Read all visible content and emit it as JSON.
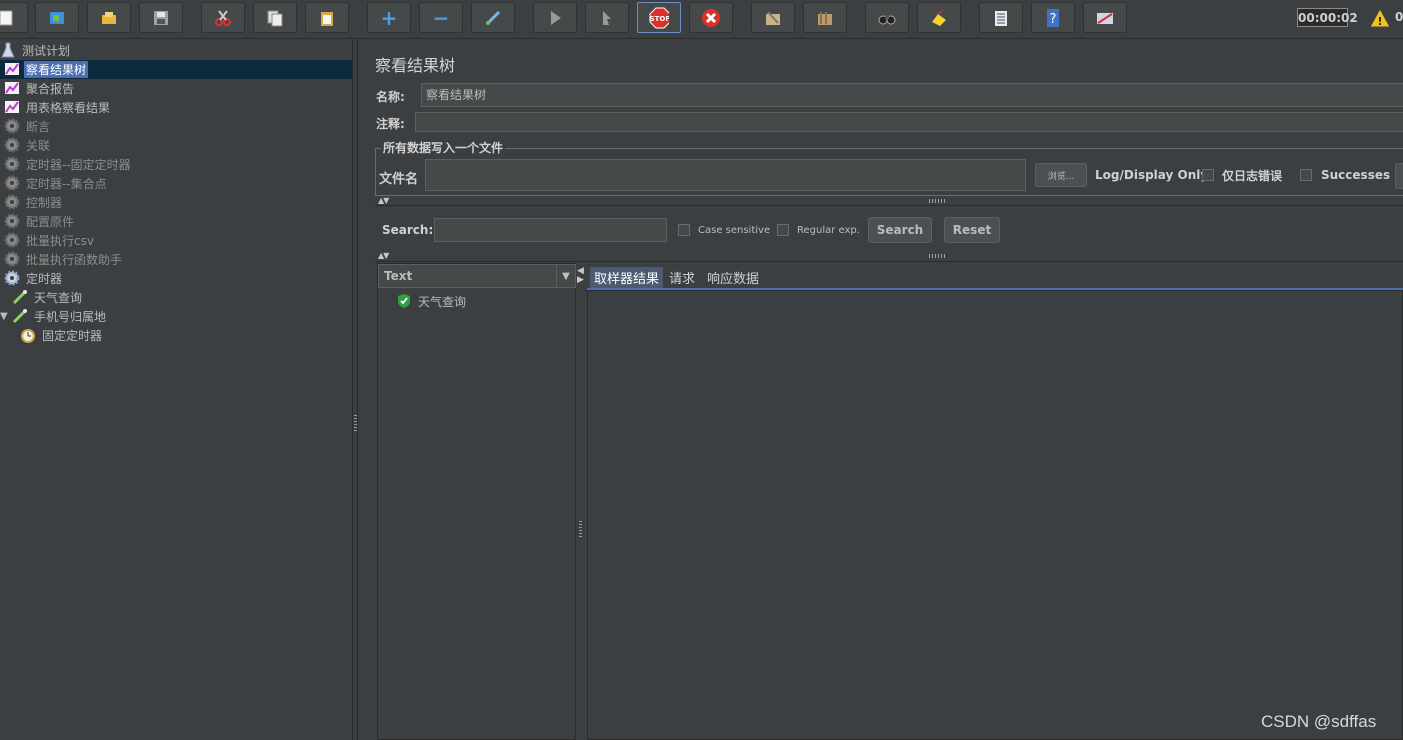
{
  "toolbar": {
    "buttons": [
      {
        "name": "new-icon"
      },
      {
        "name": "templates-icon"
      },
      {
        "name": "open-icon"
      },
      {
        "name": "save-icon"
      },
      {
        "name": "cut-icon"
      },
      {
        "name": "copy-icon"
      },
      {
        "name": "paste-icon"
      },
      {
        "name": "expand-icon"
      },
      {
        "name": "collapse-icon"
      },
      {
        "name": "toggle-icon"
      },
      {
        "name": "start-icon"
      },
      {
        "name": "start-no-pause-icon"
      },
      {
        "name": "stop-icon"
      },
      {
        "name": "shutdown-icon"
      },
      {
        "name": "remote-start-icon"
      },
      {
        "name": "remote-stop-icon"
      },
      {
        "name": "search-icon"
      },
      {
        "name": "clear-icon"
      },
      {
        "name": "function-helper-icon"
      },
      {
        "name": "help-icon"
      },
      {
        "name": "log-viewer-icon"
      }
    ],
    "stop_label": "STOP",
    "timer": "00:00:02",
    "warning_count": "0"
  },
  "tree": {
    "items": [
      {
        "label": "测试计划",
        "icon": "test-plan-icon"
      },
      {
        "label": "察看结果树",
        "icon": "listener-icon"
      },
      {
        "label": "聚合报告",
        "icon": "listener-icon"
      },
      {
        "label": "用表格察看结果",
        "icon": "listener-icon"
      },
      {
        "label": "断言",
        "icon": "gear-icon"
      },
      {
        "label": "关联",
        "icon": "gear-icon"
      },
      {
        "label": "定时器--固定定时器",
        "icon": "gear-icon"
      },
      {
        "label": "定时器--集合点",
        "icon": "gear-icon"
      },
      {
        "label": "控制器",
        "icon": "gear-icon"
      },
      {
        "label": "配置原件",
        "icon": "gear-icon"
      },
      {
        "label": "批量执行csv",
        "icon": "gear-icon"
      },
      {
        "label": "批量执行函数助手",
        "icon": "gear-icon"
      },
      {
        "label": "定时器",
        "icon": "gear-icon"
      },
      {
        "label": "天气查询",
        "icon": "sampler-icon"
      },
      {
        "label": "手机号归属地",
        "icon": "sampler-icon"
      },
      {
        "label": "固定定时器",
        "icon": "timer-icon"
      }
    ]
  },
  "panel": {
    "title": "察看结果树",
    "name_label": "名称:",
    "name_value": "察看结果树",
    "comment_label": "注释:",
    "comment_value": "",
    "file_section": "所有数据写入一个文件",
    "file_label": "文件名",
    "file_value": "",
    "browse_label": "浏览...",
    "log_display_label": "Log/Display Only:",
    "errors_only_label": "仅日志错误",
    "successes_label": "Successes"
  },
  "search": {
    "label": "Search:",
    "value": "",
    "case_sensitive_label": "Case sensitive",
    "regex_label": "Regular exp.",
    "search_button": "Search",
    "reset_button": "Reset"
  },
  "results": {
    "renderer": "Text",
    "samples": [
      {
        "label": "天气查询",
        "status": "success"
      }
    ],
    "tabs": [
      "取样器结果",
      "请求",
      "响应数据"
    ]
  },
  "watermark": "CSDN @sdffas",
  "colors": {
    "background": "#3c3f41",
    "selection": "#4b6eaf",
    "stop_red": "#d9312b",
    "success_green": "#2ea043"
  }
}
